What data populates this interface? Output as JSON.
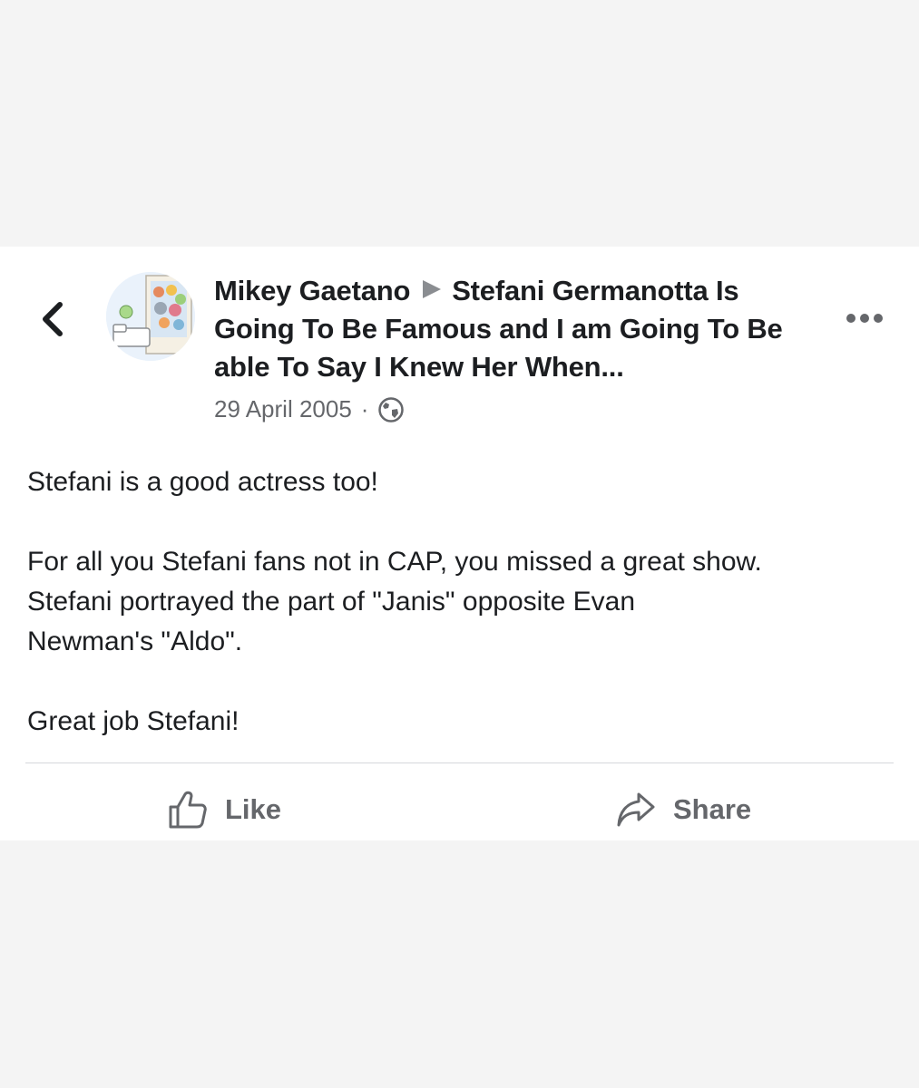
{
  "post": {
    "author": "Mikey Gaetano",
    "target": "Stefani Germanotta Is Going To Be Famous and I am Going To Be able To Say I Knew Her When...",
    "date": "29 April 2005",
    "separator": "·",
    "privacy_icon": "globe-icon",
    "body": {
      "line1": "Stefani is a good actress too!",
      "line2": "For all you Stefani fans not in CAP, you missed a great show.",
      "line3": "Stefani portrayed the part of \"Janis\" opposite Evan",
      "line4": "Newman's \"Aldo\".",
      "line5": "Great job Stefani!"
    }
  },
  "actions": {
    "like_label": "Like",
    "share_label": "Share"
  },
  "icons": {
    "back": "chevron-left-icon",
    "more": "more-options-icon",
    "like": "thumbs-up-icon",
    "share": "share-arrow-icon"
  },
  "colors": {
    "page_background": "#f4f4f4",
    "card_background": "#ffffff",
    "primary_text": "#1c1e21",
    "secondary_text": "#65676b",
    "divider": "#d6d8db"
  }
}
